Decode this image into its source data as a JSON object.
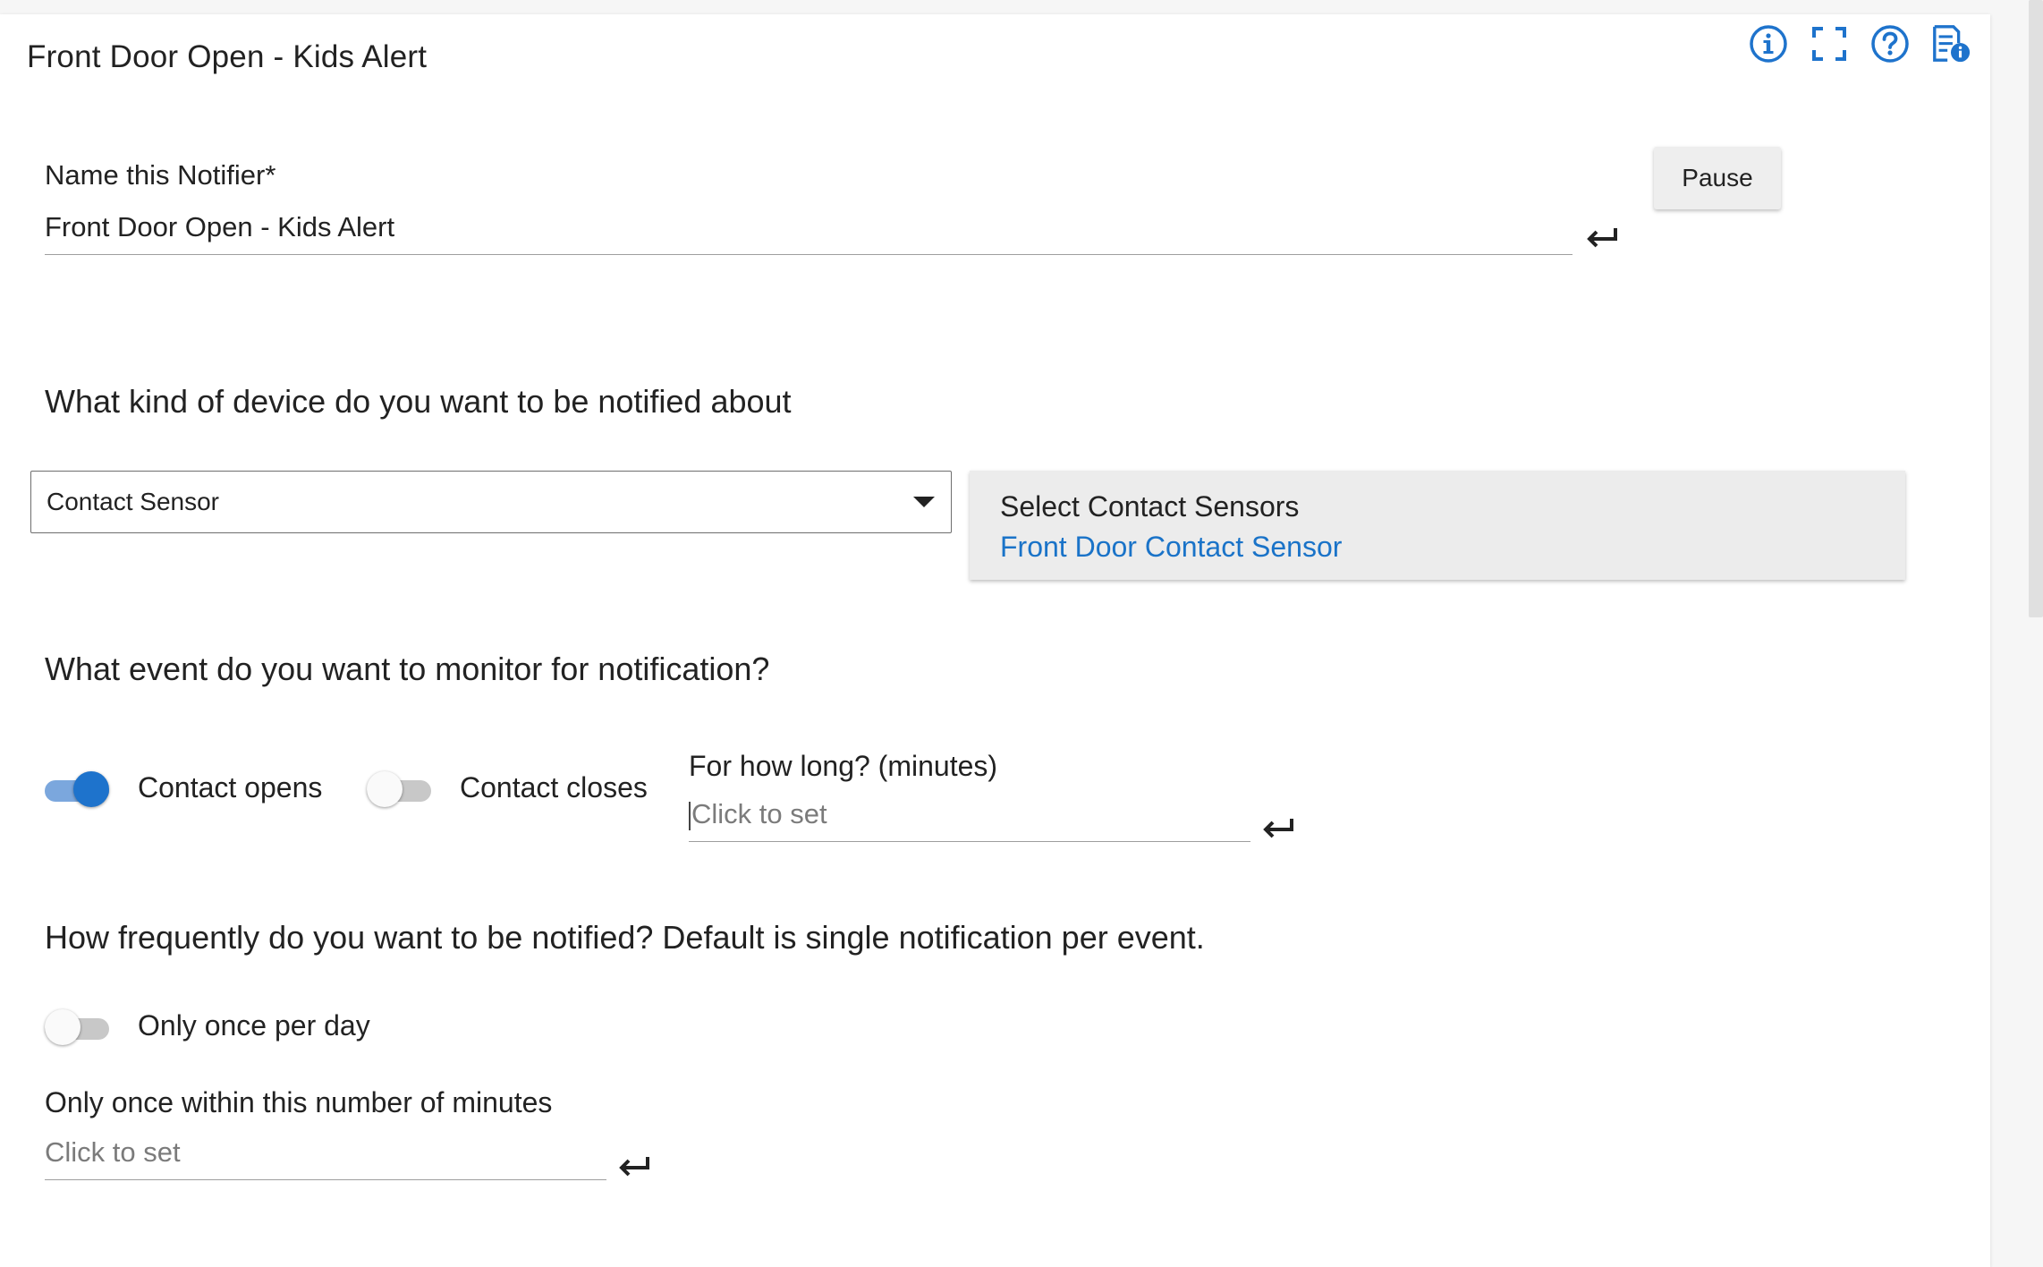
{
  "header": {
    "title": "Front Door Open - Kids Alert",
    "icons": [
      "info-icon",
      "fullscreen-icon",
      "help-icon",
      "app-info-icon"
    ],
    "accent_color": "#1e73cc"
  },
  "name_section": {
    "label": "Name this Notifier*",
    "value": "Front Door Open - Kids Alert",
    "pause_label": "Pause"
  },
  "device_section": {
    "heading": "What kind of device do you want to be notified about",
    "selected_type": "Contact Sensor",
    "device_picker_title": "Select Contact Sensors",
    "selected_device": "Front Door Contact Sensor"
  },
  "event_section": {
    "heading": "What event do you want to monitor for notification?",
    "contact_opens_label": "Contact opens",
    "contact_opens_on": true,
    "contact_closes_label": "Contact closes",
    "contact_closes_on": false,
    "duration_label": "For how long? (minutes)",
    "duration_placeholder": "Click to set"
  },
  "frequency_section": {
    "heading": "How frequently do you want to be notified?  Default is single notification per event.",
    "once_per_day_label": "Only once per day",
    "once_per_day_on": false,
    "once_within_label": "Only once within this number of minutes",
    "once_within_placeholder": "Click to set"
  }
}
